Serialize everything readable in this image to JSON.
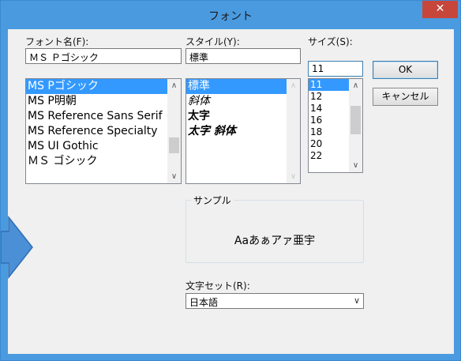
{
  "window": {
    "title": "フォント",
    "close_glyph": "✕"
  },
  "font_name": {
    "label": "フォント名(F):",
    "value": "ＭＳ Ｐゴシック",
    "items": [
      "MS Pゴシック",
      "MS P明朝",
      "MS Reference Sans Serif",
      "MS Reference Specialty",
      "MS UI Gothic",
      "ＭＳ ゴシック"
    ],
    "selected_index": 0
  },
  "style": {
    "label": "スタイル(Y):",
    "value": "標準",
    "items": [
      "標準",
      "斜体",
      "太字",
      "太字 斜体"
    ],
    "selected_index": 0
  },
  "size": {
    "label": "サイズ(S):",
    "value": "11",
    "items": [
      "11",
      "12",
      "14",
      "16",
      "18",
      "20",
      "22"
    ],
    "selected_index": 0
  },
  "buttons": {
    "ok": "OK",
    "cancel": "キャンセル"
  },
  "sample": {
    "legend": "サンプル",
    "text": "Aaあぁアァ亜宇"
  },
  "charset": {
    "label": "文字セット(R):",
    "value": "日本語"
  },
  "icons": {
    "scroll_up": "up-chevron",
    "scroll_down": "down-chevron",
    "dropdown": "down-chevron",
    "pointer_arrow": "right-arrow"
  },
  "colors": {
    "title_bar": "#4a9ae0",
    "close_button": "#c7463c",
    "selection": "#3399ff",
    "pointer_arrow": "#4b8fd6"
  }
}
